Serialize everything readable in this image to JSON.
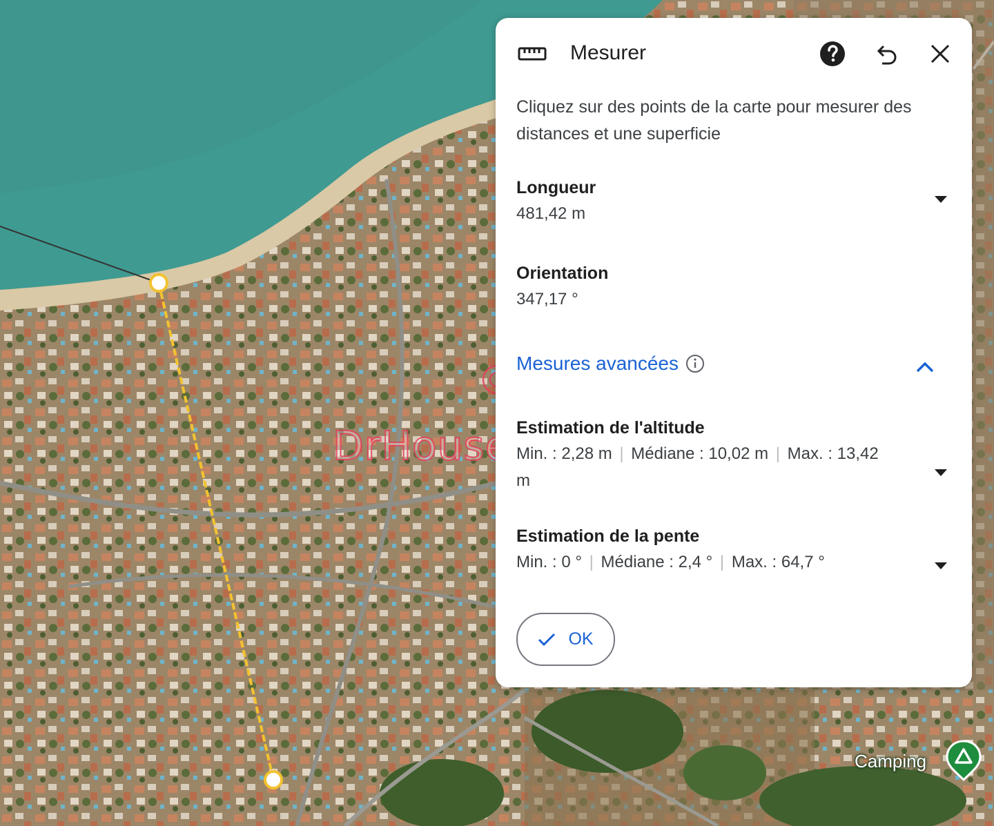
{
  "panel": {
    "title": "Mesurer",
    "instructions": "Cliquez sur des points de la carte pour mesurer des distances et une superficie",
    "length": {
      "label": "Longueur",
      "value": "481,42 m"
    },
    "orientation": {
      "label": "Orientation",
      "value": "347,17 °"
    },
    "advanced": {
      "link_label": "Mesures avancées",
      "expanded": true,
      "altitude": {
        "label": "Estimation de l'altitude",
        "min": "Min. : 2,28 m",
        "median": "Médiane : 10,02 m",
        "max": "Max. : 13,42 m"
      },
      "slope": {
        "label": "Estimation de la pente",
        "min": "Min. : 0 °",
        "median": "Médiane : 2,4 °",
        "max": "Max. : 64,7 °"
      }
    },
    "ok_label": "OK",
    "separator": "|"
  },
  "map": {
    "poi_label": "Camping",
    "watermark": "DrHouse-Immo",
    "watermark_symbol": "©",
    "colors": {
      "sea": "#3f9a92",
      "beach": "#d9c9a6",
      "urban": "#a08a6e",
      "measure_line": "#f2c230",
      "accent_blue": "#1a62d4",
      "camping_green": "#1e8e3e"
    },
    "icons": [
      "ruler-icon",
      "help-icon",
      "undo-icon",
      "close-icon",
      "info-icon",
      "chevron-up-icon",
      "caret-down-icon",
      "check-icon",
      "camping-icon"
    ]
  }
}
